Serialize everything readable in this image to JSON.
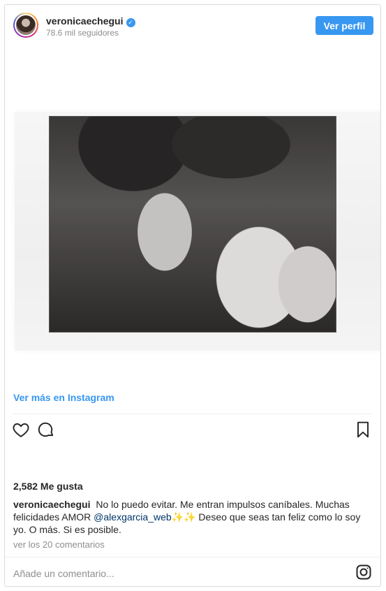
{
  "header": {
    "username": "veronicaechegui",
    "verified_symbol": "✓",
    "followers": "78.6 mil seguidores",
    "view_profile": "Ver perfil"
  },
  "media": {
    "more_link": "Ver más en Instagram"
  },
  "actions": {
    "icons": [
      "heart-icon",
      "comment-icon",
      "bookmark-icon"
    ]
  },
  "likes": "2,582 Me gusta",
  "caption": {
    "username": "veronicaechegui",
    "text_before": "No lo puedo evitar. Me entran impulsos caníbales. Muchas felicidades AMOR ",
    "mention": "@alexgarcia_web",
    "text_after": "✨✨ Deseo que seas tan feliz como lo soy yo. O más. Si es posible."
  },
  "comments_link": "ver los 20 comentarios",
  "add_comment_placeholder": "Añade un comentario...",
  "colors": {
    "accent": "#3897f0",
    "muted": "#8e8e8e",
    "text": "#262626"
  }
}
